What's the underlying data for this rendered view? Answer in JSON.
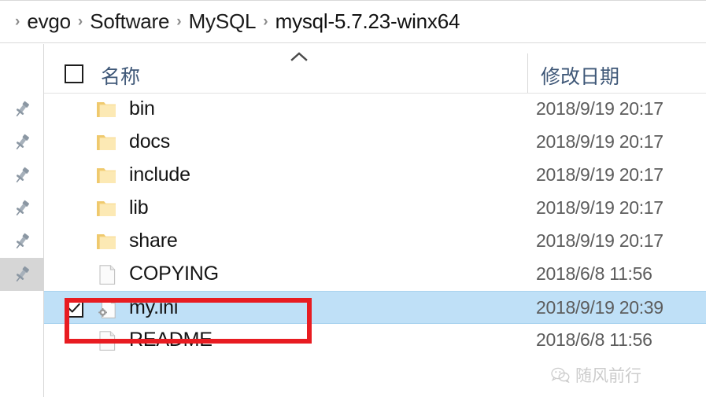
{
  "breadcrumb": {
    "separator": "›",
    "items": [
      {
        "label": "evgo"
      },
      {
        "label": "Software"
      },
      {
        "label": "MySQL"
      },
      {
        "label": "mysql-5.7.23-winx64"
      }
    ]
  },
  "sidebar": {
    "pins": [
      {
        "icon": "pushpin-icon",
        "active": false
      },
      {
        "icon": "pushpin-icon",
        "active": false
      },
      {
        "icon": "pushpin-icon",
        "active": false
      },
      {
        "icon": "pushpin-icon",
        "active": false
      },
      {
        "icon": "pushpin-icon",
        "active": false
      },
      {
        "icon": "pushpin-icon",
        "active": true
      }
    ]
  },
  "columns": {
    "select_all_checked": false,
    "name_label": "名称",
    "date_label": "修改日期",
    "sort_caret": "sort-ascending-icon"
  },
  "files": [
    {
      "name": "bin",
      "date": "2018/9/19 20:17",
      "type": "folder",
      "icon": "folder-icon",
      "selected": false,
      "checked": false
    },
    {
      "name": "docs",
      "date": "2018/9/19 20:17",
      "type": "folder",
      "icon": "folder-icon",
      "selected": false,
      "checked": false
    },
    {
      "name": "include",
      "date": "2018/9/19 20:17",
      "type": "folder",
      "icon": "folder-icon",
      "selected": false,
      "checked": false
    },
    {
      "name": "lib",
      "date": "2018/9/19 20:17",
      "type": "folder",
      "icon": "folder-icon",
      "selected": false,
      "checked": false
    },
    {
      "name": "share",
      "date": "2018/9/19 20:17",
      "type": "folder",
      "icon": "folder-icon",
      "selected": false,
      "checked": false
    },
    {
      "name": "COPYING",
      "date": "2018/6/8 11:56",
      "type": "file",
      "icon": "document-icon",
      "selected": false,
      "checked": false
    },
    {
      "name": "my.ini",
      "date": "2018/9/19 20:39",
      "type": "config",
      "icon": "config-file-icon",
      "selected": true,
      "checked": true
    },
    {
      "name": "README",
      "date": "2018/6/8 11:56",
      "type": "file",
      "icon": "document-icon",
      "selected": false,
      "checked": false
    }
  ],
  "annotation": {
    "target": "my.ini",
    "color": "#e81c21"
  },
  "watermark": {
    "text": "随风前行",
    "icon": "wechat-icon"
  },
  "colors": {
    "selection_blue": "#bfe0f7",
    "header_text": "#3f5878",
    "folder_yellow": "#fbd879",
    "annotation_red": "#e81c21",
    "pin_gray": "#8b97a3"
  }
}
